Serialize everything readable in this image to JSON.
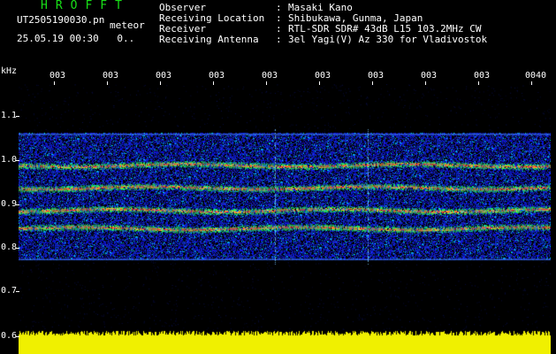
{
  "header": {
    "logo": "HROFFT",
    "file_name": "UT2505190030.pn",
    "mode": "meteor",
    "datetime": "25.05.19 00:30",
    "datetime_suffix": "0.."
  },
  "station_info": [
    {
      "label": "Observer",
      "value": "Masaki Kano"
    },
    {
      "label": "Receiving Location",
      "value": "Shibukawa, Gunma, Japan"
    },
    {
      "label": "Receiver",
      "value": "RTL-SDR SDR# 43dB L15 103.2MHz CW"
    },
    {
      "label": "Receiving Antenna",
      "value": "3el Yagi(V) Az 330 for Vladivostok"
    }
  ],
  "y_axis": {
    "unit": "kHz",
    "ticks": [
      "1.1",
      "1.0",
      "0.9",
      "0.8",
      "0.7",
      "0.6"
    ]
  },
  "x_axis": {
    "ticks": [
      "003",
      "003",
      "003",
      "003",
      "003",
      "003",
      "003",
      "003",
      "003",
      "0040"
    ]
  },
  "colors": {
    "background": "#000000",
    "logo": "#18e018",
    "text": "#ffffff",
    "power_fill": "#f0f000",
    "echo_red": "#ff2040",
    "noise_blue": "#1a2cc8"
  },
  "spectrogram": {
    "freq_range_khz": [
      0.6,
      1.15
    ],
    "band_top_khz": 1.04,
    "band_bottom_khz": 0.76,
    "echo_lines_khz": [
      0.97,
      0.92,
      0.87,
      0.83
    ]
  }
}
